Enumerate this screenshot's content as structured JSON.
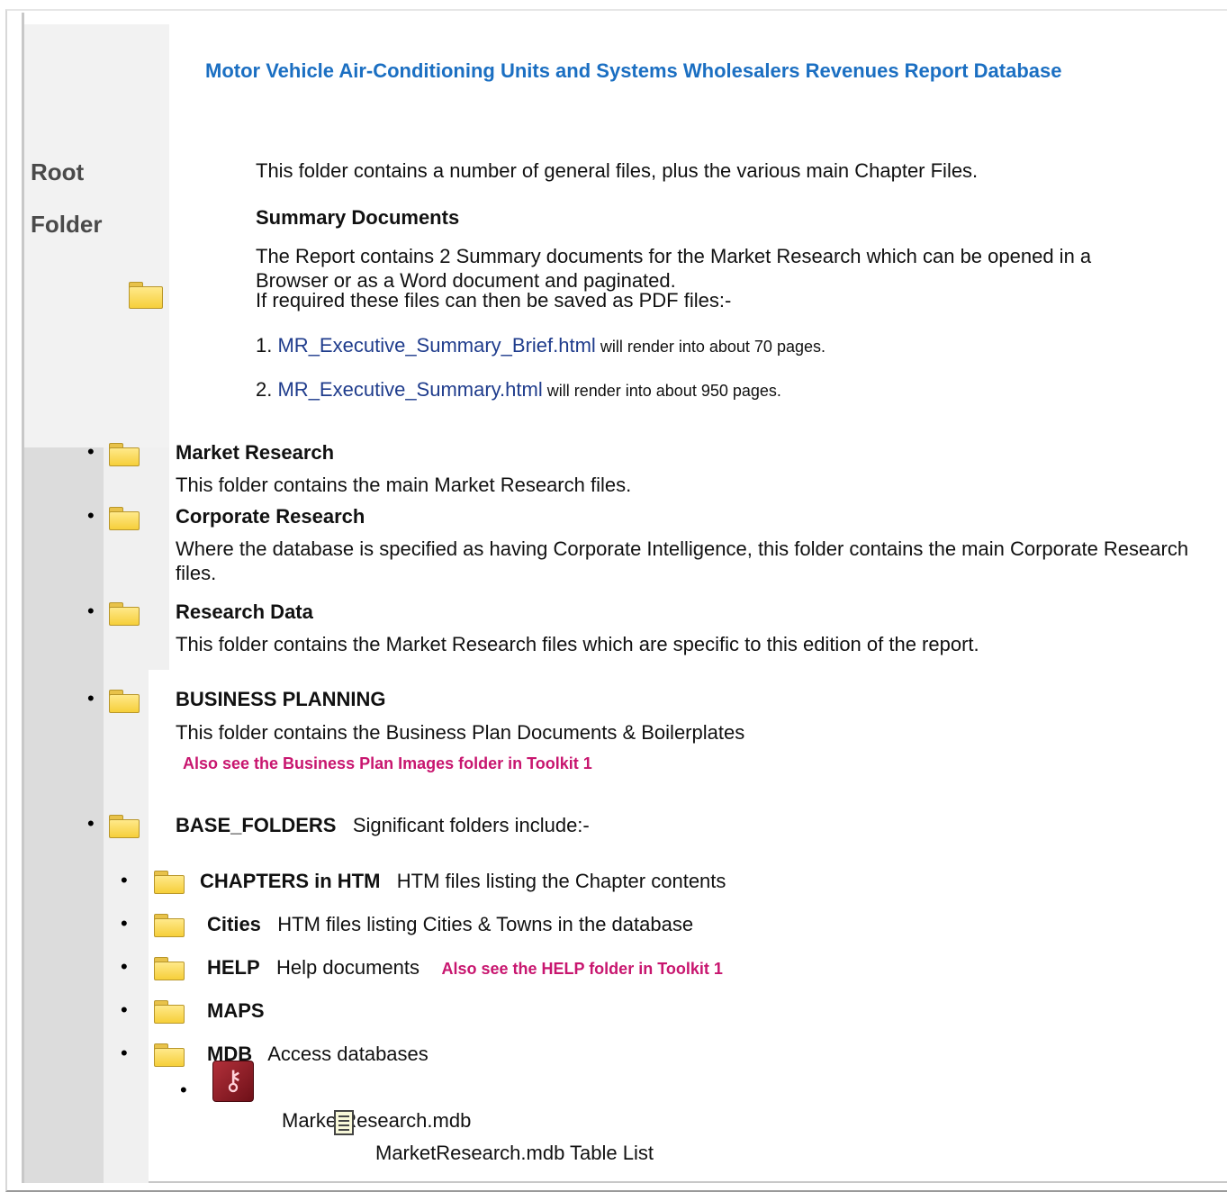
{
  "title": "Motor Vehicle Air-Conditioning Units and Systems Wholesalers Revenues Report Database",
  "sidebar": {
    "root_line1": "Root",
    "root_line2": "Folder"
  },
  "intro": "This folder contains a number of general files, plus the various main Chapter Files.",
  "summary": {
    "heading": "Summary Documents",
    "text": "The Report contains 2 Summary documents for the Market Research which can be opened in a Browser or as a Word document and paginated.",
    "pdf_text": "If required these files can then be saved as PDF files:-",
    "items": [
      {
        "num": "1.",
        "link": "MR_Executive_Summary_Brief.html",
        "rest": " will render into about 70 pages."
      },
      {
        "num": "2.",
        "link": "MR_Executive_Summary.html",
        "rest": " will render into about 950 pages."
      }
    ]
  },
  "folders": [
    {
      "name": "Market Research",
      "desc": "This folder contains the main Market Research files."
    },
    {
      "name": "Corporate Research",
      "desc": "Where the database is specified as having Corporate Intelligence, this folder contains the main Corporate Research files."
    },
    {
      "name": "Research Data",
      "desc": "This folder contains the Market Research files which are specific to this edition of the report."
    },
    {
      "name": "BUSINESS PLANNING",
      "desc": "This folder contains the Business Plan Documents & Boilerplates",
      "note": "Also see the Business Plan Images folder in Toolkit 1"
    },
    {
      "name": "BASE_FOLDERS",
      "desc": "Significant folders include:-"
    }
  ],
  "subfolders": [
    {
      "name": "CHAPTERS in HTM",
      "desc": "HTM files listing the Chapter contents"
    },
    {
      "name": "Cities",
      "desc": "HTM files listing Cities & Towns in the database"
    },
    {
      "name": "HELP",
      "desc": "Help documents",
      "note": "Also see the HELP folder in Toolkit 1"
    },
    {
      "name": "MAPS",
      "desc": ""
    },
    {
      "name": "MDB",
      "desc": "Access databases"
    }
  ],
  "mdb": {
    "file": "MarketResearch.mdb",
    "table_list": "MarketResearch.mdb Table List"
  },
  "bullet": "•",
  "icons": {
    "folder": "folder-icon",
    "access": "access-database-icon",
    "document": "document-icon"
  },
  "colors": {
    "title": "#1b6fc2",
    "link": "#1f3c8c",
    "note": "#c8166f"
  }
}
